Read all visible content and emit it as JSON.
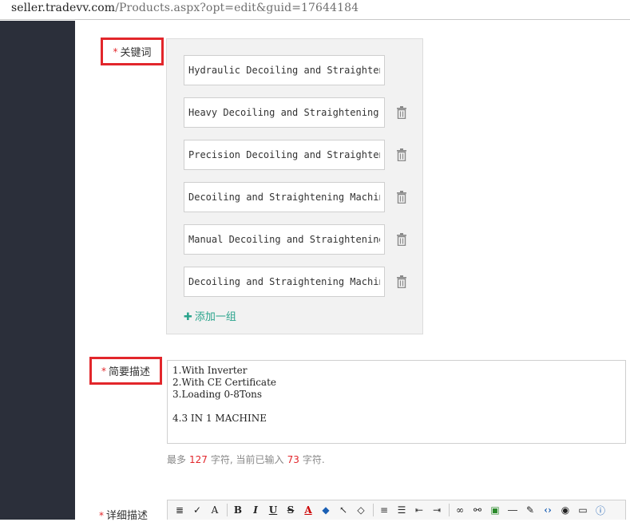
{
  "browser": {
    "url_host": "seller.tradevv.com",
    "url_path": "/Products.aspx?opt=edit&guid=17644184"
  },
  "required_mark": "*",
  "keywords": {
    "label": "关键词",
    "items": [
      "Hydraulic Decoiling and Straightening",
      "Heavy Decoiling and Straightening Machine",
      "Precision Decoiling and Straightening",
      "Decoiling and Straightening Machine",
      "Manual Decoiling and Straightening",
      "Decoiling and Straightening Machine"
    ],
    "add_group": "添加一组",
    "trash_icon": "trash-icon"
  },
  "brief": {
    "label": "简要描述",
    "value": "1.With Inverter\n2.With CE Certificate\n3.Loading 0-8Tons\n\n4.3 IN 1 MACHINE",
    "counter_prefix": "最多",
    "max": "127",
    "counter_mid": "字符, 当前已输入",
    "current": "73",
    "counter_suffix": "字符."
  },
  "detail": {
    "label": "详细描述",
    "toolbar": [
      {
        "name": "format-icon",
        "glyph": "≣"
      },
      {
        "name": "spellcheck-icon",
        "glyph": "✓"
      },
      {
        "name": "find-replace-icon",
        "glyph": "A"
      },
      {
        "name": "sep"
      },
      {
        "name": "bold-icon",
        "glyph": "B"
      },
      {
        "name": "italic-icon",
        "glyph": "I"
      },
      {
        "name": "underline-icon",
        "glyph": "U"
      },
      {
        "name": "strikethrough-icon",
        "glyph": "S"
      },
      {
        "name": "font-color-icon",
        "glyph": "A"
      },
      {
        "name": "highlight-icon",
        "glyph": "◆"
      },
      {
        "name": "select-icon",
        "glyph": "↖"
      },
      {
        "name": "eraser-icon",
        "glyph": "◇"
      },
      {
        "name": "sep"
      },
      {
        "name": "align-left-icon",
        "glyph": "≡"
      },
      {
        "name": "bullet-list-icon",
        "glyph": "☰"
      },
      {
        "name": "outdent-icon",
        "glyph": "⇤"
      },
      {
        "name": "indent-icon",
        "glyph": "⇥"
      },
      {
        "name": "sep"
      },
      {
        "name": "link-icon",
        "glyph": "∞"
      },
      {
        "name": "unlink-icon",
        "glyph": "⚯"
      },
      {
        "name": "image-icon",
        "glyph": "▣"
      },
      {
        "name": "horizontal-rule-icon",
        "glyph": "―"
      },
      {
        "name": "edit-icon",
        "glyph": "✎"
      },
      {
        "name": "source-icon",
        "glyph": "‹›"
      },
      {
        "name": "preview-icon",
        "glyph": "◉"
      },
      {
        "name": "fullscreen-icon",
        "glyph": "▭"
      },
      {
        "name": "about-icon",
        "glyph": "ⓘ"
      }
    ]
  }
}
